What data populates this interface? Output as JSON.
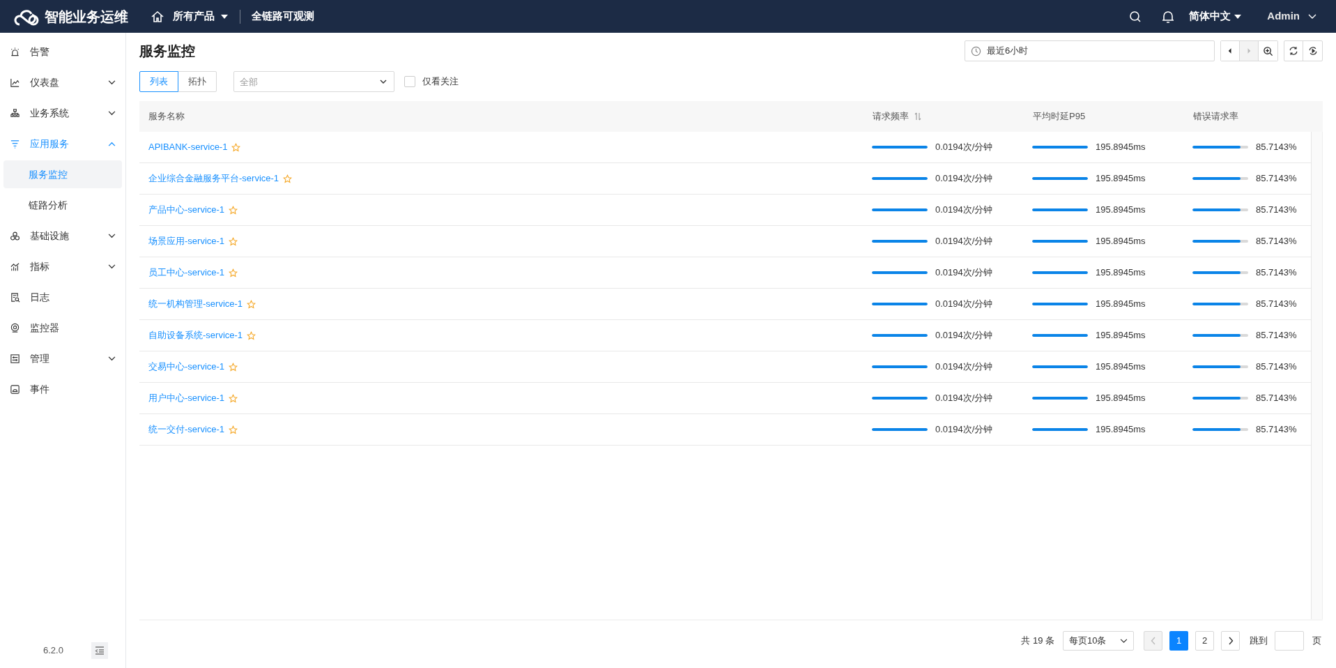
{
  "topbar": {
    "brand": "智能业务运维",
    "product_menu": "所有产品",
    "nav_link": "全链路可观测",
    "language": "简体中文",
    "user": "Admin"
  },
  "sidebar": {
    "items": [
      {
        "label": "告警",
        "selected": false
      },
      {
        "label": "仪表盘",
        "selected": false,
        "expanded": false
      },
      {
        "label": "业务系统",
        "selected": false,
        "expanded": false
      },
      {
        "label": "应用服务",
        "selected": true,
        "expanded": true,
        "children": [
          {
            "label": "服务监控",
            "selected": true
          },
          {
            "label": "链路分析",
            "selected": false
          }
        ]
      },
      {
        "label": "基础设施",
        "selected": false,
        "expanded": false
      },
      {
        "label": "指标",
        "selected": false,
        "expanded": false
      },
      {
        "label": "日志",
        "selected": false
      },
      {
        "label": "监控器",
        "selected": false
      },
      {
        "label": "管理",
        "selected": false,
        "expanded": false
      },
      {
        "label": "事件",
        "selected": false
      }
    ],
    "version": "6.2.0"
  },
  "page": {
    "title": "服务监控",
    "time_range": "最近6小时",
    "time_buttons": [
      {
        "disabled": false
      },
      {
        "disabled": true
      },
      {
        "disabled": false
      }
    ],
    "view_tabs": [
      {
        "label": "列表",
        "selected": true
      },
      {
        "label": "拓扑",
        "selected": false
      }
    ],
    "filter": {
      "placeholder": "全部"
    },
    "follow_only": {
      "label": "仅看关注",
      "checked": false
    }
  },
  "table": {
    "columns": [
      {
        "label": "服务名称",
        "sortable": false
      },
      {
        "label": "请求频率",
        "sortable": true
      },
      {
        "label": "平均时延P95",
        "sortable": false
      },
      {
        "label": "错误请求率",
        "sortable": false
      }
    ],
    "rows": [
      {
        "name": "APIBANK-service-1",
        "starred": false,
        "rate": {
          "text": "0.0194次/分钟",
          "level": 1
        },
        "p95": {
          "text": "195.8945ms",
          "level": 1
        },
        "error": {
          "text": "85.7143%",
          "level": 0.857
        }
      },
      {
        "name": "企业综合金融服务平台-service-1",
        "starred": false,
        "rate": {
          "text": "0.0194次/分钟",
          "level": 1
        },
        "p95": {
          "text": "195.8945ms",
          "level": 1
        },
        "error": {
          "text": "85.7143%",
          "level": 0.857
        }
      },
      {
        "name": "产品中心-service-1",
        "starred": false,
        "rate": {
          "text": "0.0194次/分钟",
          "level": 1
        },
        "p95": {
          "text": "195.8945ms",
          "level": 1
        },
        "error": {
          "text": "85.7143%",
          "level": 0.857
        }
      },
      {
        "name": "场景应用-service-1",
        "starred": false,
        "rate": {
          "text": "0.0194次/分钟",
          "level": 1
        },
        "p95": {
          "text": "195.8945ms",
          "level": 1
        },
        "error": {
          "text": "85.7143%",
          "level": 0.857
        }
      },
      {
        "name": "员工中心-service-1",
        "starred": false,
        "rate": {
          "text": "0.0194次/分钟",
          "level": 1
        },
        "p95": {
          "text": "195.8945ms",
          "level": 1
        },
        "error": {
          "text": "85.7143%",
          "level": 0.857
        }
      },
      {
        "name": "统一机构管理-service-1",
        "starred": false,
        "rate": {
          "text": "0.0194次/分钟",
          "level": 1
        },
        "p95": {
          "text": "195.8945ms",
          "level": 1
        },
        "error": {
          "text": "85.7143%",
          "level": 0.857
        }
      },
      {
        "name": "自助设备系统-service-1",
        "starred": false,
        "rate": {
          "text": "0.0194次/分钟",
          "level": 1
        },
        "p95": {
          "text": "195.8945ms",
          "level": 1
        },
        "error": {
          "text": "85.7143%",
          "level": 0.857
        }
      },
      {
        "name": "交易中心-service-1",
        "starred": false,
        "rate": {
          "text": "0.0194次/分钟",
          "level": 1
        },
        "p95": {
          "text": "195.8945ms",
          "level": 1
        },
        "error": {
          "text": "85.7143%",
          "level": 0.857
        }
      },
      {
        "name": "用户中心-service-1",
        "starred": false,
        "rate": {
          "text": "0.0194次/分钟",
          "level": 1
        },
        "p95": {
          "text": "195.8945ms",
          "level": 1
        },
        "error": {
          "text": "85.7143%",
          "level": 0.857
        }
      },
      {
        "name": "统一交付-service-1",
        "starred": false,
        "rate": {
          "text": "0.0194次/分钟",
          "level": 1
        },
        "p95": {
          "text": "195.8945ms",
          "level": 1
        },
        "error": {
          "text": "85.7143%",
          "level": 0.857
        }
      }
    ]
  },
  "pagination": {
    "total": "共 19 条",
    "page_size": "每页10条",
    "prev_disabled": true,
    "next_disabled": false,
    "pages": [
      {
        "label": "1",
        "selected": true
      },
      {
        "label": "2",
        "selected": false
      }
    ],
    "jump_label": "跳到",
    "page_unit": "页"
  }
}
